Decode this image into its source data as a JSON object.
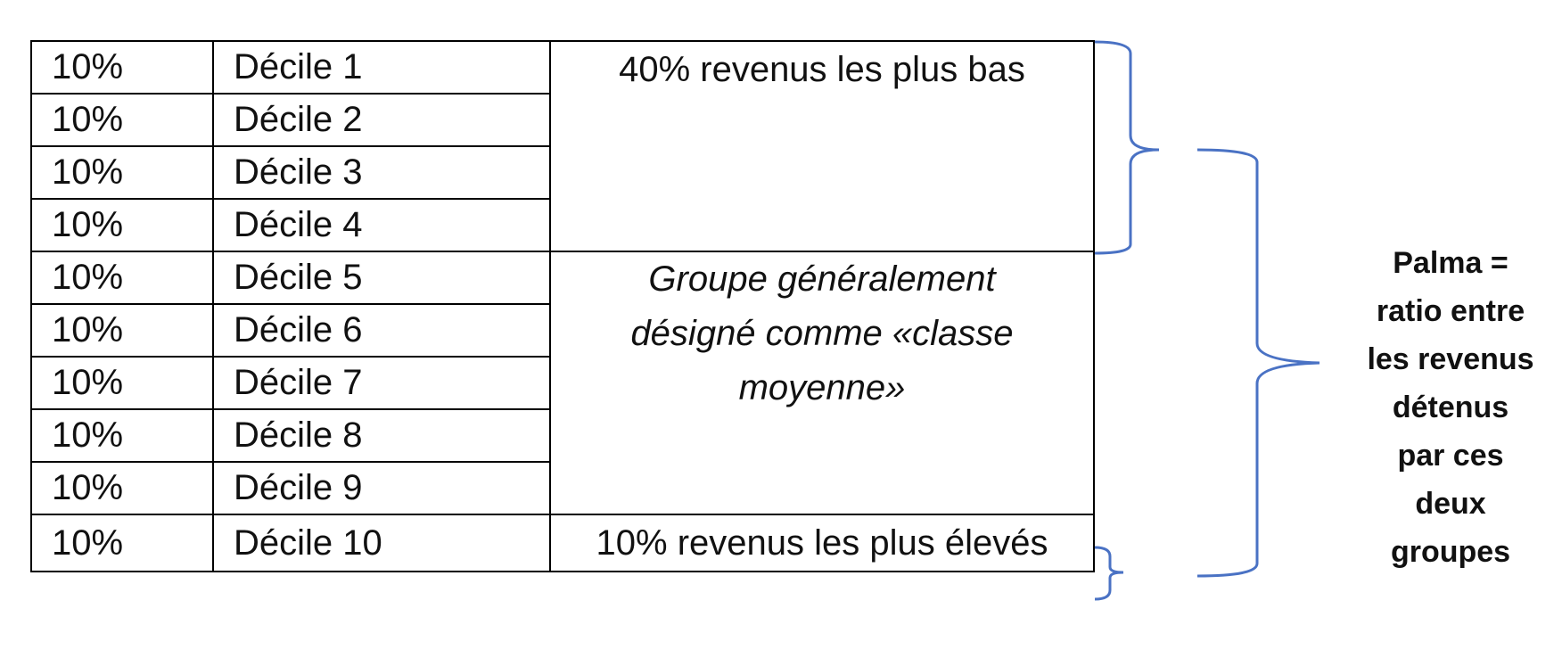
{
  "rows": [
    {
      "share": "10%",
      "decile": "Décile 1"
    },
    {
      "share": "10%",
      "decile": "Décile 2"
    },
    {
      "share": "10%",
      "decile": "Décile 3"
    },
    {
      "share": "10%",
      "decile": "Décile 4"
    },
    {
      "share": "10%",
      "decile": "Décile 5"
    },
    {
      "share": "10%",
      "decile": "Décile 6"
    },
    {
      "share": "10%",
      "decile": "Décile 7"
    },
    {
      "share": "10%",
      "decile": "Décile 8"
    },
    {
      "share": "10%",
      "decile": "Décile 9"
    },
    {
      "share": "10%",
      "decile": "Décile 10"
    }
  ],
  "groups": {
    "bottom_40": "40% revenus les plus bas",
    "middle": "Groupe généralement désigné comme «classe moyenne»",
    "top_10": "10% revenus les plus élevés"
  },
  "palma_label_lines": [
    "Palma =",
    "ratio entre",
    "les revenus",
    "détenus",
    "par ces",
    "deux",
    "groupes"
  ],
  "colors": {
    "brace": "#4a72c4",
    "border": "#000000"
  }
}
